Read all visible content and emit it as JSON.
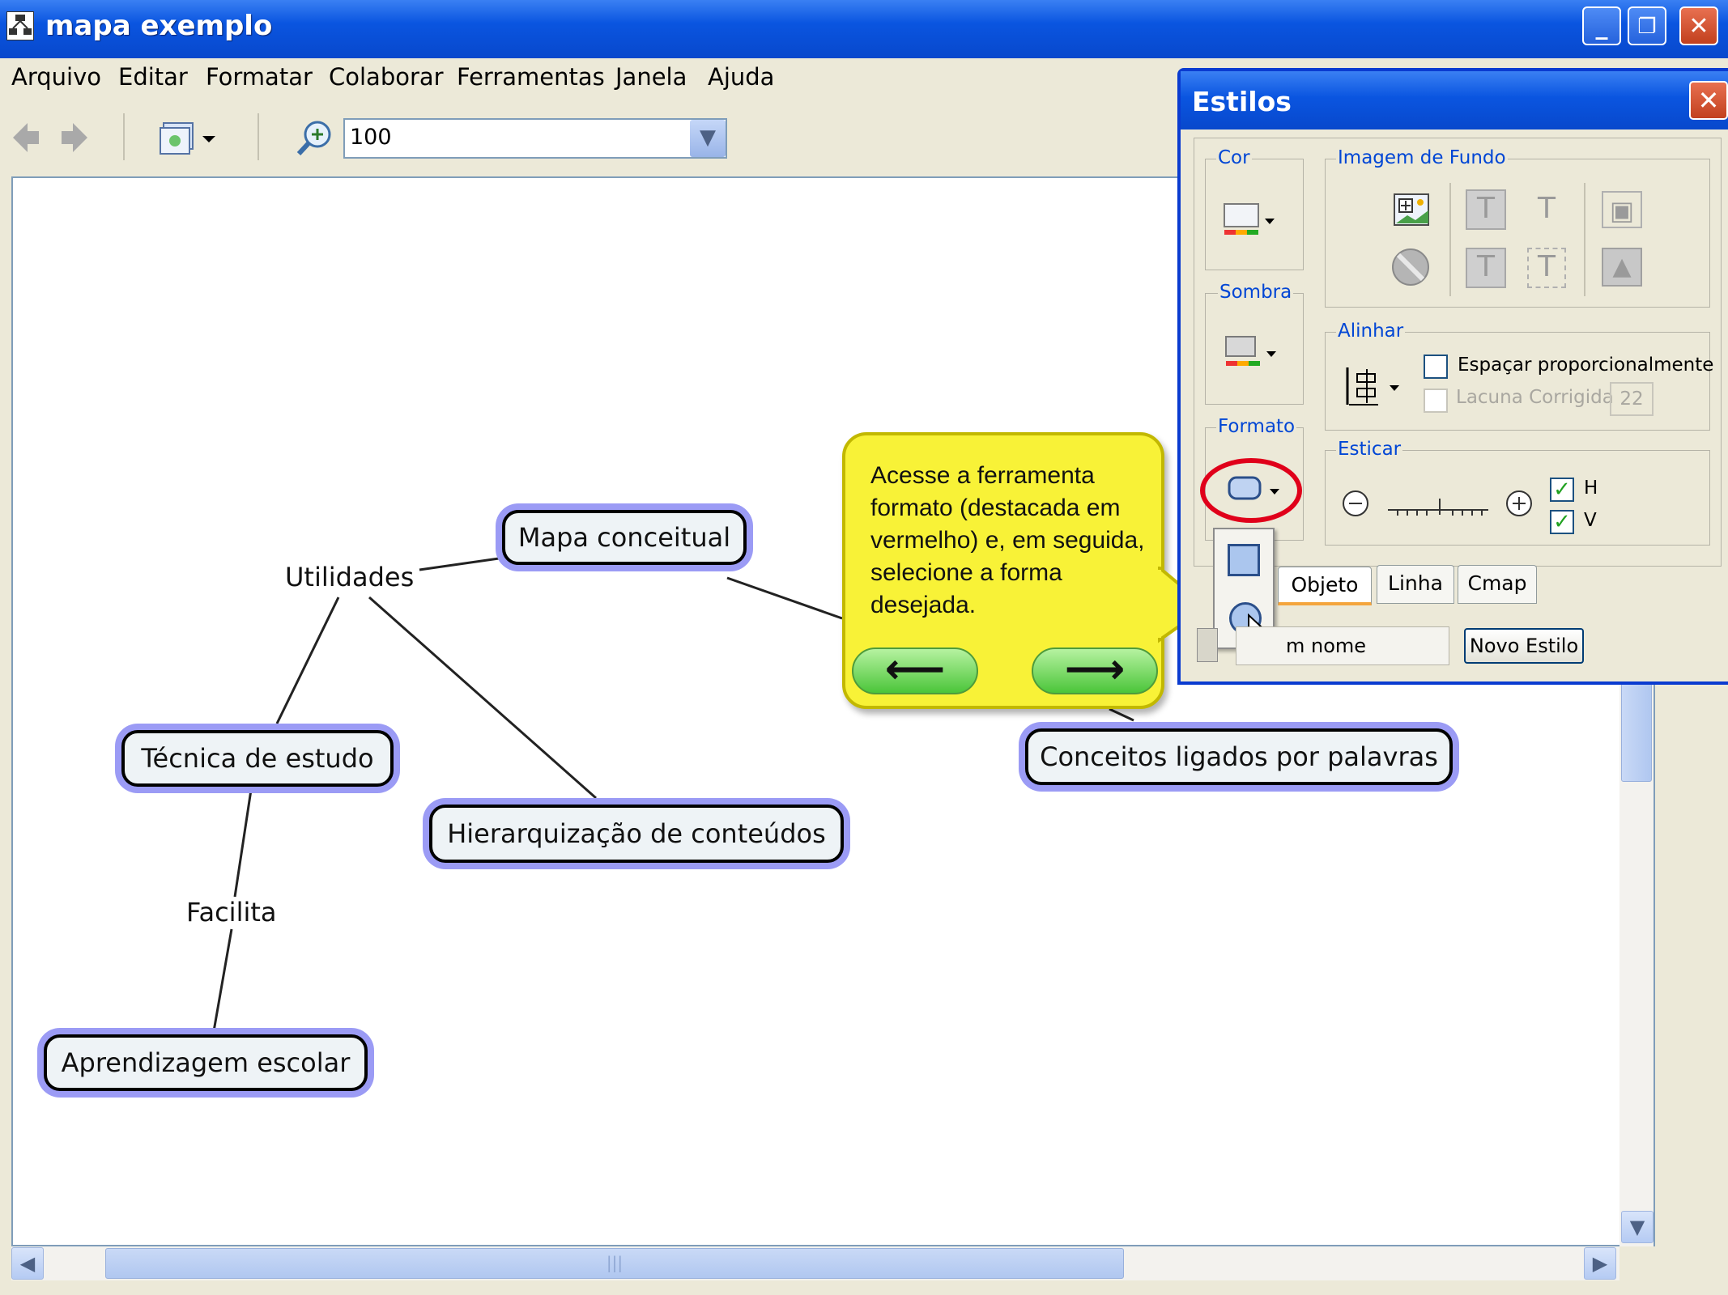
{
  "window": {
    "title": "mapa exemplo"
  },
  "menu": [
    "Arquivo",
    "Editar",
    "Formatar",
    "Colaborar",
    "Ferramentas",
    "Janela",
    "Ajuda"
  ],
  "toolbar": {
    "zoom_value": "100"
  },
  "concept_map": {
    "nodes": [
      {
        "id": "mapa-conceitual",
        "label": "Mapa conceitual"
      },
      {
        "id": "tecnica-de-estudo",
        "label": "Técnica de estudo"
      },
      {
        "id": "hierarquizacao",
        "label": "Hierarquização de conteúdos"
      },
      {
        "id": "conceitos-ligados",
        "label": "Conceitos ligados por palavras"
      },
      {
        "id": "aprendizagem-escolar",
        "label": "Aprendizagem escolar"
      }
    ],
    "linking_phrases": [
      {
        "id": "utilidades",
        "label": "Utilidades"
      },
      {
        "id": "facilita",
        "label": "Facilita"
      }
    ]
  },
  "styles_panel": {
    "title": "Estilos",
    "close_label": "✕",
    "groups": {
      "cor": "Cor",
      "imagem_de_fundo": "Imagem de Fundo",
      "sombra": "Sombra",
      "alinhar": "Alinhar",
      "formato": "Formato",
      "esticar": "Esticar"
    },
    "espacar_label": "Espaçar proporcionalmente",
    "lacuna_label": "Lacuna Corrigida",
    "lacuna_value": "22",
    "esticar_h": "H",
    "esticar_v": "V",
    "tabs": [
      "Objeto",
      "Linha",
      "Cmap"
    ],
    "active_tab": "Objeto",
    "style_name_partial": "m nome",
    "new_style_button": "Novo Estilo"
  },
  "callout": {
    "text": "Acesse a ferramenta formato (destacada em vermelho) e, em seguida, selecione a forma desejada.",
    "prev_symbol": "⟵",
    "next_symbol": "⟶"
  },
  "colors": {
    "title_bar": "#0A55E0",
    "node_halo": "#9B9BF5",
    "callout_bg": "#F8F237",
    "highlight_ring": "#E0001A",
    "nav_button": "#4BC53A"
  }
}
